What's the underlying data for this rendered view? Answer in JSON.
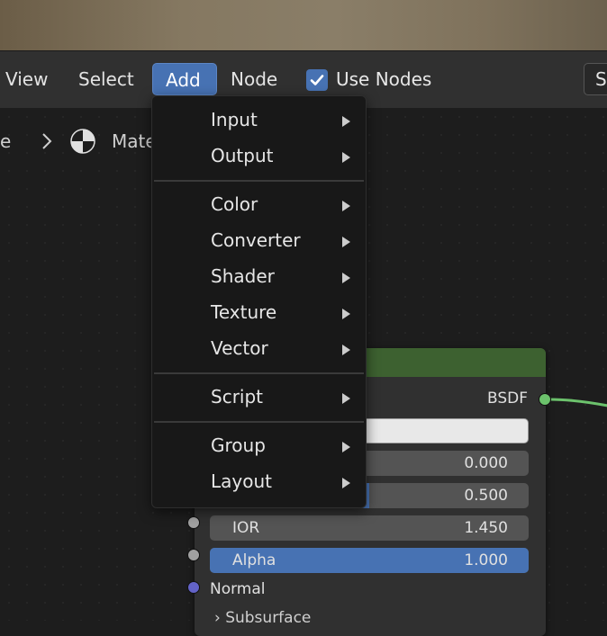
{
  "header": {
    "menus": [
      {
        "label": "View"
      },
      {
        "label": "Select"
      },
      {
        "label": "Add"
      },
      {
        "label": "Node"
      }
    ],
    "use_nodes_label": "Use Nodes",
    "use_nodes_checked": true,
    "right_button_label": "S"
  },
  "breadcrumb": {
    "prev_fragment": "e",
    "current_fragment": "Mate"
  },
  "node": {
    "output_label": "BSDF",
    "fields": [
      {
        "name": "",
        "value": "0.000",
        "fill": 0
      },
      {
        "name": "",
        "value": "0.500",
        "fill": 0.5
      },
      {
        "name": "IOR",
        "value": "1.450",
        "fill": 0
      },
      {
        "name": "Alpha",
        "value": "1.000",
        "fill": 1
      }
    ],
    "normal_label": "Normal",
    "subsurface_label": "Subsurface"
  },
  "add_menu": {
    "groups": [
      [
        "Input",
        "Output"
      ],
      [
        "Color",
        "Converter",
        "Shader",
        "Texture",
        "Vector"
      ],
      [
        "Script"
      ],
      [
        "Group",
        "Layout"
      ]
    ]
  },
  "colors": {
    "accent": "#4772b3",
    "node_header": "#3d6130",
    "link": "#6cc26c",
    "menu_bg": "#181818"
  }
}
